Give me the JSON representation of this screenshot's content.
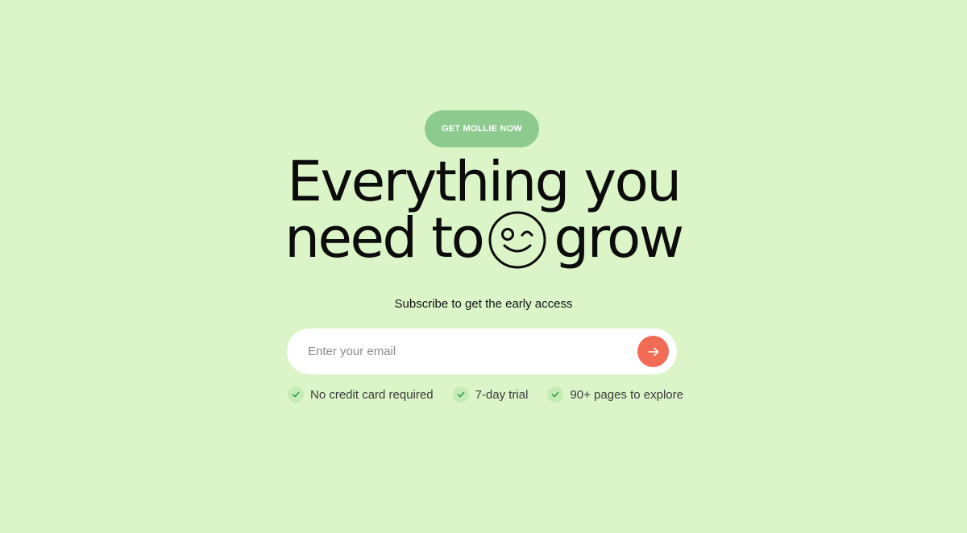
{
  "colors": {
    "background": "#dbf5c9",
    "cta_pill": "#8ccb8d",
    "submit_button": "#f26b55",
    "check_badge": "#c6ecb6",
    "check_mark": "#2f9e4a"
  },
  "hero": {
    "cta_label": "GET MOLLIE NOW",
    "headline_line1": "Everything you",
    "headline_line2_before": "need to",
    "headline_line2_after": "grow",
    "headline_icon": "winking-smiley-icon",
    "subtitle": "Subscribe to get the early access"
  },
  "form": {
    "email_placeholder": "Enter your email",
    "email_value": "",
    "submit_icon": "arrow-right-icon"
  },
  "features": [
    {
      "icon": "check-icon",
      "label": "No credit card required"
    },
    {
      "icon": "check-icon",
      "label": "7-day trial"
    },
    {
      "icon": "check-icon",
      "label": "90+ pages to explore"
    }
  ]
}
